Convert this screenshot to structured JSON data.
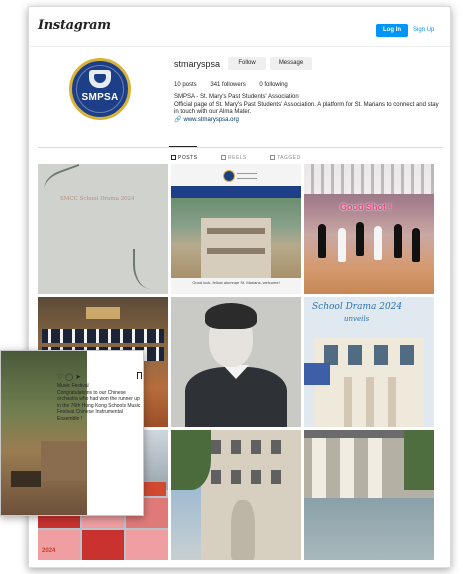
{
  "header": {
    "logo": "Instagram",
    "login_label": "Log In",
    "signup_label": "Sign Up"
  },
  "profile": {
    "username": "stmaryspsa",
    "follow_label": "Follow",
    "message_label": "Message",
    "avatar_text": "SMPSA",
    "posts": "10 posts",
    "followers": "341 followers",
    "following": "0 following",
    "bio_name": "SMPSA - St. Mary's Past Students' Association",
    "bio_text": "Official page of St. Mary's Past Students' Association. A platform for St. Marians to connect and stay in touch with our Alma Mater.",
    "link": "www.stmaryspsa.org"
  },
  "tabs": [
    {
      "label": "POSTS",
      "active": true
    },
    {
      "label": "REELS",
      "active": false
    },
    {
      "label": "TAGGED",
      "active": false
    }
  ],
  "posts": {
    "p1_caption": "SMCC School Drama 2024",
    "p2_caption": "Good luck, fellow alumnae St. Marians, welcome!",
    "p3_caption": "Good Shot !",
    "p6_title": "School Drama 2024",
    "p6_subtitle": "unveils",
    "p7_number": "2024"
  },
  "overlay": {
    "title": "Music Festival",
    "caption": "Congratulations to our Chinese orchestra who had won the runner up in the 76th Hong Kong Schools Music Festival Chinese Instrumental Ensemble !"
  },
  "colors": {
    "accent": "#0095f6",
    "avatar_bg": "#1d3f88",
    "avatar_ring": "#d9b23a"
  }
}
